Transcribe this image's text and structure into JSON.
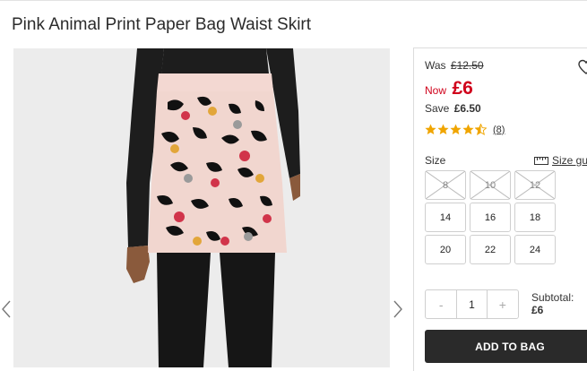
{
  "product": {
    "title": "Pink Animal Print Paper Bag Waist Skirt"
  },
  "pricing": {
    "was_label": "Was",
    "was_price": "£12.50",
    "now_label": "Now",
    "now_price": "£6",
    "save_label": "Save",
    "save_amount": "£6.50"
  },
  "rating": {
    "stars": 4.5,
    "count": "(8)"
  },
  "sizes": {
    "label": "Size",
    "guide_label": "Size gui",
    "options": [
      {
        "label": "8",
        "available": false
      },
      {
        "label": "10",
        "available": false
      },
      {
        "label": "12",
        "available": false
      },
      {
        "label": "14",
        "available": true
      },
      {
        "label": "16",
        "available": true
      },
      {
        "label": "18",
        "available": true
      },
      {
        "label": "20",
        "available": true
      },
      {
        "label": "22",
        "available": true
      },
      {
        "label": "24",
        "available": true
      }
    ]
  },
  "quantity": {
    "minus": "-",
    "value": "1",
    "plus": "+"
  },
  "subtotal": {
    "label": "Subtotal:",
    "value": "£6"
  },
  "actions": {
    "add_to_bag": "ADD TO BAG"
  },
  "icons": {
    "gallery_prev": "chevron-left-icon",
    "gallery_next": "chevron-right-icon",
    "wishlist": "heart-icon",
    "size_guide": "ruler-icon",
    "rating": "star-icon"
  },
  "colors": {
    "price_red": "#d0021b",
    "star_gold": "#f0a500",
    "button_dark": "#2a2a2a"
  }
}
